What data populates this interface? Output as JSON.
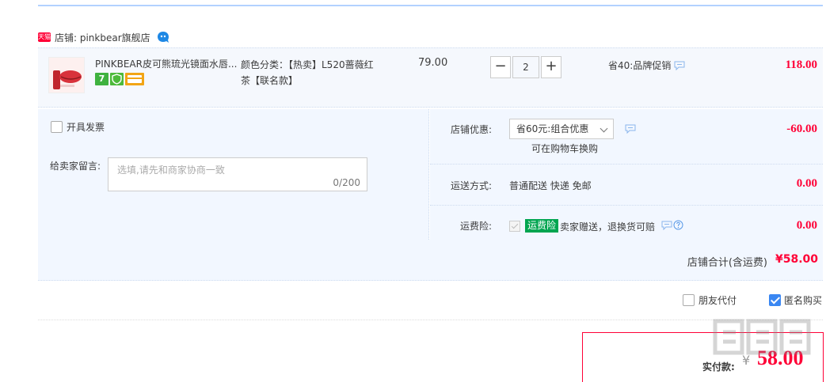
{
  "shop": {
    "platform_badge": "天猫",
    "label": "店铺: pinkbear旗舰店"
  },
  "item": {
    "title": "PINKBEAR皮可熊琉光镜面水唇...",
    "sku_line1": "颜色分类：【热卖】L520蔷薇红",
    "sku_line2": "茶【联名款】",
    "badges": [
      "7"
    ],
    "price": "79.00",
    "quantity": "2",
    "qty_minus": "−",
    "qty_plus": "+",
    "promo": "省40:品牌促销",
    "subtotal": "118.00"
  },
  "invoice": {
    "label": "开具发票"
  },
  "note": {
    "label": "给卖家留言:",
    "placeholder": "选填,请先和商家协商一致",
    "counter": "0/200"
  },
  "discount": {
    "label": "店铺优惠:",
    "selected": "省60元:组合优惠",
    "hint": "可在购物车换购",
    "amount": "-60.00"
  },
  "shipping": {
    "label": "运送方式:",
    "value": "普通配送 快递 免邮",
    "amount": "0.00"
  },
  "insurance": {
    "label": "运费险:",
    "tag": "运费险",
    "text": "卖家赠送，退换货可赔",
    "amount": "0.00"
  },
  "shop_total": {
    "label": "店铺合计(含运费)",
    "amount": "¥58.00"
  },
  "options": {
    "friend_pay": "朋友代付",
    "anonymous": "匿名购买"
  },
  "payment": {
    "label": "实付款:",
    "currency": "¥",
    "amount": "58.00"
  },
  "colors": {
    "accent_red": "#ff0036",
    "row_bg": "#f2f7ff",
    "check_blue": "#3a87f2",
    "insurance_green": "#00a550"
  }
}
